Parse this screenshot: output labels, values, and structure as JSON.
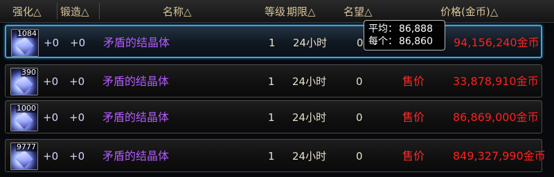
{
  "headers": {
    "enhance": "强化△",
    "forge": "锻造△",
    "name": "名称△",
    "level": "等级",
    "period": "期限△",
    "fame": "名望△",
    "price": "价格(金币)△"
  },
  "rows": [
    {
      "qty": "1084",
      "enhance": "+0",
      "forge": "+0",
      "name": "矛盾的结晶体",
      "level": "1",
      "period": "24小时",
      "fame": "0",
      "sell_label": "",
      "price": "94,156,240金币"
    },
    {
      "qty": "390",
      "enhance": "+0",
      "forge": "+0",
      "name": "矛盾的结晶体",
      "level": "1",
      "period": "24小时",
      "fame": "0",
      "sell_label": "售价",
      "price": "33,878,910金币"
    },
    {
      "qty": "1000",
      "enhance": "+0",
      "forge": "+0",
      "name": "矛盾的结晶体",
      "level": "1",
      "period": "24小时",
      "fame": "0",
      "sell_label": "售价",
      "price": "86,869,000金币"
    },
    {
      "qty": "9777",
      "enhance": "+0",
      "forge": "+0",
      "name": "矛盾的结晶体",
      "level": "1",
      "period": "24小时",
      "fame": "0",
      "sell_label": "售价",
      "price": "849,327,990金币"
    }
  ],
  "tooltip": {
    "avg_label": "平均：",
    "avg_value": "86,888",
    "each_label": "每个：",
    "each_value": "86,860"
  },
  "colors": {
    "name": "#b45cff",
    "price": "#ff2020",
    "selected_border": "#3fa3e0"
  },
  "item_icon": "crystal-icon"
}
